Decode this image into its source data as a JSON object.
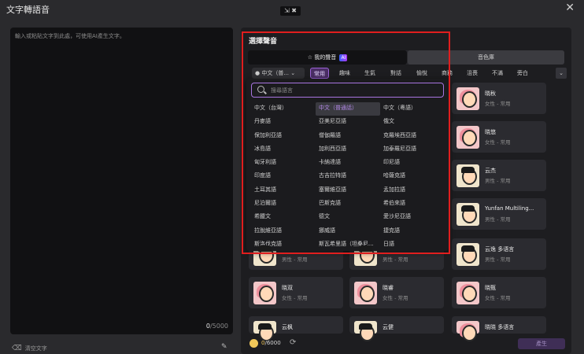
{
  "window": {
    "title": "文字轉語音",
    "close_glyph": "✕",
    "mini_badge": "⇲ ✖"
  },
  "editor": {
    "placeholder": "輸入或粘貼文字到此處，可使用AI產生文字。",
    "count_current": "0",
    "count_max": "/5000"
  },
  "footer_left": {
    "clear_label": "清空文字"
  },
  "voice_panel": {
    "title": "選擇聲音",
    "tabs": {
      "my_voice": "我的聲音",
      "ai_badge": "AI",
      "library": "音色庫"
    },
    "language_selected": "中文（普...",
    "categories": [
      "常用",
      "趣味",
      "生氣",
      "對話",
      "愉悅",
      "商務",
      "沮喪",
      "不滿",
      "旁白"
    ],
    "active_category": "常用",
    "search_placeholder": "搜尋語言",
    "languages": [
      "中文（台灣）",
      "中文（普通話）",
      "中文（粵語）",
      "丹麥語",
      "亞美尼亞語",
      "俄文",
      "保加利亞語",
      "僧伽羅語",
      "克羅埃西亞語",
      "冰島語",
      "加利西亞語",
      "加泰羅尼亞語",
      "匈牙利語",
      "卡納達語",
      "印尼語",
      "印度語",
      "古吉拉特語",
      "哈薩克語",
      "土耳其語",
      "塞爾維亞語",
      "孟加拉語",
      "尼泊爾語",
      "巴斯克語",
      "希伯來語",
      "希臘文",
      "德文",
      "愛沙尼亞語",
      "拉脫維亞語",
      "挪威語",
      "捷克語",
      "斯洛伐克語",
      "斯瓦希里語（坦桑尼...",
      "日語"
    ],
    "selected_language": "中文（普通話）",
    "voices": [
      {
        "name": "晓秋",
        "meta": "女性 - 常用",
        "gender": "female"
      },
      {
        "name": "晓悠",
        "meta": "女性 - 常用",
        "gender": "female"
      },
      {
        "name": "云杰",
        "meta": "男性 - 常用",
        "gender": "male"
      },
      {
        "name": "Yunfan Multiling...",
        "meta": "男性 - 常用",
        "gender": "male"
      },
      {
        "name": "",
        "meta": "男性 - 常用",
        "gender": "male"
      },
      {
        "name": "云逸 多语言",
        "meta": "男性 - 常用",
        "gender": "male"
      },
      {
        "name": "",
        "meta": "男性 - 常用",
        "gender": "male"
      },
      {
        "name": "晓双",
        "meta": "女性 - 常用",
        "gender": "female"
      },
      {
        "name": "晓睿",
        "meta": "女性 - 常用",
        "gender": "female"
      },
      {
        "name": "晓甄",
        "meta": "女性 - 常用",
        "gender": "female"
      },
      {
        "name": "云枫",
        "meta": "",
        "gender": "male"
      },
      {
        "name": "云健",
        "meta": "",
        "gender": "male"
      },
      {
        "name": "晓晓 多语言",
        "meta": "",
        "gender": "female"
      }
    ]
  },
  "bottom": {
    "coins": "0",
    "coins_total": "/6000",
    "generate_label": "產生"
  }
}
